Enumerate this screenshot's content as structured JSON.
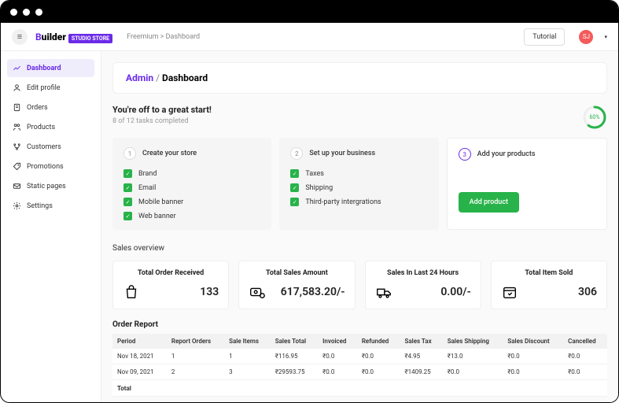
{
  "header": {
    "logo_prefix": "B",
    "logo_text": "uilder",
    "logo_badge": "STUDIO STORE",
    "breadcrumb": "Freemium > Dashboard",
    "tutorial_label": "Tutorial",
    "avatar_initials": "SJ"
  },
  "sidebar": {
    "items": [
      {
        "label": "Dashboard",
        "icon": "chart"
      },
      {
        "label": "Edit profile",
        "icon": "user"
      },
      {
        "label": "Orders",
        "icon": "doc"
      },
      {
        "label": "Products",
        "icon": "family"
      },
      {
        "label": "Customers",
        "icon": "branch"
      },
      {
        "label": "Promotions",
        "icon": "tag"
      },
      {
        "label": "Static pages",
        "icon": "mail"
      },
      {
        "label": "Settings",
        "icon": "gear"
      }
    ]
  },
  "page": {
    "breadcrumb_main": "Admin",
    "breadcrumb_sep": " / ",
    "breadcrumb_cur": "Dashboard"
  },
  "tasks": {
    "title": "You're off to a great start!",
    "subtitle": "8 of 12 tasks completed",
    "percent": "60%",
    "percent_val": 60
  },
  "setup_cards": [
    {
      "step": "1",
      "title": "Create your store",
      "items": [
        "Brand",
        "Email",
        "Mobile banner",
        "Web banner"
      ]
    },
    {
      "step": "2",
      "title": "Set up your business",
      "items": [
        "Taxes",
        "Shipping",
        "Third-party intergrations"
      ]
    },
    {
      "step": "3",
      "title": "Add your products",
      "button": "Add product"
    }
  ],
  "overview_title": "Sales overview",
  "stats": [
    {
      "title": "Total Order Received",
      "value": "133",
      "icon": "bag"
    },
    {
      "title": "Total Sales Amount",
      "value": "617,583.20/-",
      "icon": "money"
    },
    {
      "title": "Sales In Last 24 Hours",
      "value": "0.00/-",
      "icon": "truck"
    },
    {
      "title": "Total Item Sold",
      "value": "306",
      "icon": "box"
    }
  ],
  "report": {
    "title": "Order Report",
    "headers": [
      "Period",
      "Report Orders",
      "Sale Items",
      "Sales Total",
      "Invoiced",
      "Refunded",
      "Sales Tax",
      "Sales Shipping",
      "Sales Discount",
      "Cancelled"
    ],
    "rows": [
      {
        "c": [
          "Nov 18, 2021",
          "1",
          "1",
          "₹116.95",
          "₹0.0",
          "₹0.0",
          "₹4.95",
          "₹13.0",
          "₹0.0",
          "₹0.0"
        ]
      },
      {
        "c": [
          "Nov 09, 2021",
          "2",
          "3",
          "₹29593.75",
          "₹0.0",
          "₹0.0",
          "₹1409.25",
          "₹0.0",
          "₹0.0",
          "₹0.0"
        ]
      }
    ],
    "total_label": "Total"
  }
}
